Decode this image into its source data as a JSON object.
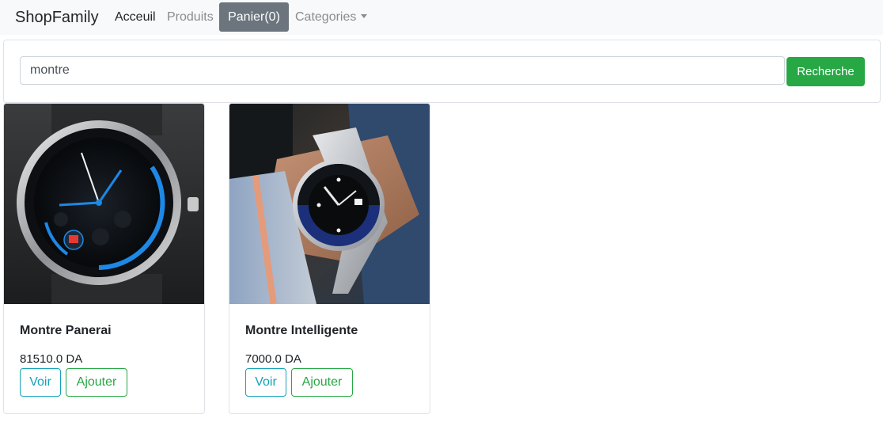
{
  "navbar": {
    "brand": "ShopFamily",
    "links": {
      "accueil": "Acceuil",
      "produits": "Produits",
      "panier": "Panier(0)",
      "categories": "Categories"
    }
  },
  "search": {
    "value": "montre",
    "button": "Recherche"
  },
  "products": [
    {
      "title": "Montre Panerai",
      "price": "81510.0 DA",
      "view": "Voir",
      "add": "Ajouter"
    },
    {
      "title": "Montre Intelligente",
      "price": "7000.0 DA",
      "view": "Voir",
      "add": "Ajouter"
    }
  ],
  "colors": {
    "primary_success": "#28a745",
    "info": "#17a2b8",
    "secondary": "#6c757d",
    "navbar_bg": "#f8f9fa"
  }
}
